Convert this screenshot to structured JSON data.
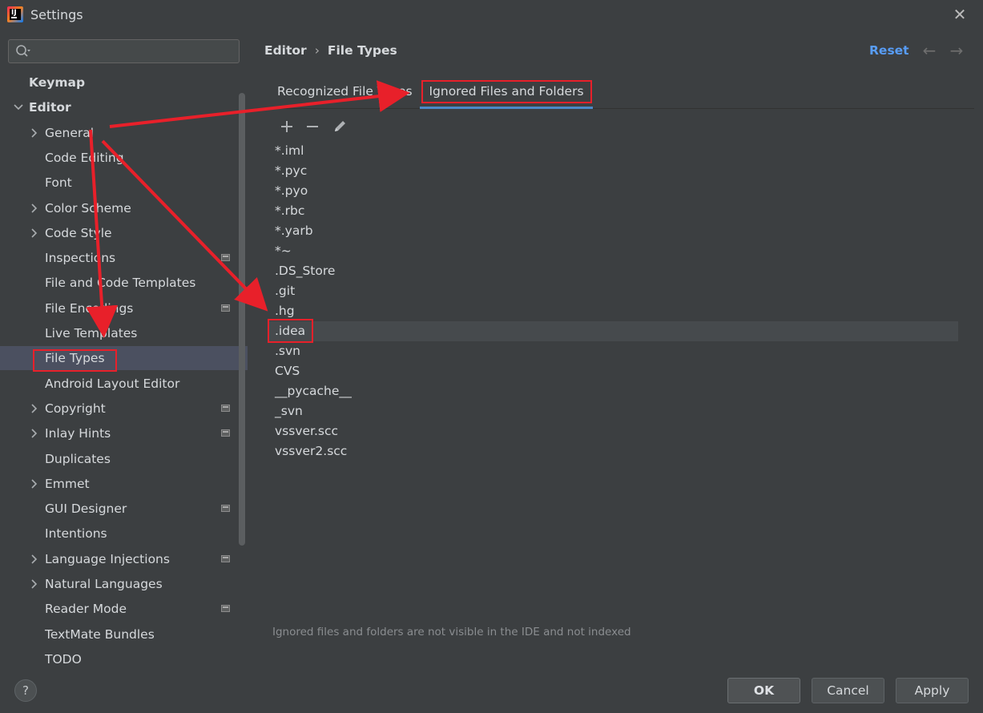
{
  "window": {
    "title": "Settings",
    "close_glyph": "✕"
  },
  "search": {
    "placeholder": "",
    "value": ""
  },
  "sidebar": {
    "items": [
      {
        "label": "Keymap",
        "bold": true,
        "expandable": false,
        "expanded": false,
        "indent": 0,
        "project": false
      },
      {
        "label": "Editor",
        "bold": true,
        "expandable": true,
        "expanded": true,
        "indent": 0,
        "project": false
      },
      {
        "label": "General",
        "bold": false,
        "expandable": true,
        "expanded": false,
        "indent": 1,
        "project": false
      },
      {
        "label": "Code Editing",
        "bold": false,
        "expandable": false,
        "expanded": false,
        "indent": 1,
        "project": false
      },
      {
        "label": "Font",
        "bold": false,
        "expandable": false,
        "expanded": false,
        "indent": 1,
        "project": false
      },
      {
        "label": "Color Scheme",
        "bold": false,
        "expandable": true,
        "expanded": false,
        "indent": 1,
        "project": false
      },
      {
        "label": "Code Style",
        "bold": false,
        "expandable": true,
        "expanded": false,
        "indent": 1,
        "project": false
      },
      {
        "label": "Inspections",
        "bold": false,
        "expandable": false,
        "expanded": false,
        "indent": 1,
        "project": true
      },
      {
        "label": "File and Code Templates",
        "bold": false,
        "expandable": false,
        "expanded": false,
        "indent": 1,
        "project": false
      },
      {
        "label": "File Encodings",
        "bold": false,
        "expandable": false,
        "expanded": false,
        "indent": 1,
        "project": true
      },
      {
        "label": "Live Templates",
        "bold": false,
        "expandable": false,
        "expanded": false,
        "indent": 1,
        "project": false
      },
      {
        "label": "File Types",
        "bold": false,
        "expandable": false,
        "expanded": false,
        "indent": 1,
        "project": false,
        "selected": true
      },
      {
        "label": "Android Layout Editor",
        "bold": false,
        "expandable": false,
        "expanded": false,
        "indent": 1,
        "project": false
      },
      {
        "label": "Copyright",
        "bold": false,
        "expandable": true,
        "expanded": false,
        "indent": 1,
        "project": true
      },
      {
        "label": "Inlay Hints",
        "bold": false,
        "expandable": true,
        "expanded": false,
        "indent": 1,
        "project": true
      },
      {
        "label": "Duplicates",
        "bold": false,
        "expandable": false,
        "expanded": false,
        "indent": 1,
        "project": false
      },
      {
        "label": "Emmet",
        "bold": false,
        "expandable": true,
        "expanded": false,
        "indent": 1,
        "project": false
      },
      {
        "label": "GUI Designer",
        "bold": false,
        "expandable": false,
        "expanded": false,
        "indent": 1,
        "project": true
      },
      {
        "label": "Intentions",
        "bold": false,
        "expandable": false,
        "expanded": false,
        "indent": 1,
        "project": false
      },
      {
        "label": "Language Injections",
        "bold": false,
        "expandable": true,
        "expanded": false,
        "indent": 1,
        "project": true
      },
      {
        "label": "Natural Languages",
        "bold": false,
        "expandable": true,
        "expanded": false,
        "indent": 1,
        "project": false
      },
      {
        "label": "Reader Mode",
        "bold": false,
        "expandable": false,
        "expanded": false,
        "indent": 1,
        "project": true
      },
      {
        "label": "TextMate Bundles",
        "bold": false,
        "expandable": false,
        "expanded": false,
        "indent": 1,
        "project": false
      },
      {
        "label": "TODO",
        "bold": false,
        "expandable": false,
        "expanded": false,
        "indent": 1,
        "project": false
      }
    ]
  },
  "header": {
    "breadcrumb_parent": "Editor",
    "breadcrumb_sep": "›",
    "breadcrumb_current": "File Types",
    "reset_label": "Reset",
    "back_glyph": "←",
    "forward_glyph": "→"
  },
  "tabs": [
    {
      "label": "Recognized File Types",
      "active": false
    },
    {
      "label": "Ignored Files and Folders",
      "active": true
    }
  ],
  "toolbar": {
    "add_icon": "plus-icon",
    "remove_icon": "minus-icon",
    "edit_icon": "pencil-icon"
  },
  "ignored_list": {
    "items": [
      "*.iml",
      "*.pyc",
      "*.pyo",
      "*.rbc",
      "*.yarb",
      "*~",
      ".DS_Store",
      ".git",
      ".hg",
      ".idea",
      ".svn",
      "CVS",
      "__pycache__",
      "_svn",
      "vssver.scc",
      "vssver2.scc"
    ],
    "selected": ".idea"
  },
  "hint": "Ignored files and folders are not visible in the IDE and not indexed",
  "buttons": {
    "help_label": "?",
    "ok_label": "OK",
    "cancel_label": "Cancel",
    "apply_label": "Apply"
  },
  "colors": {
    "background": "#3c3f41",
    "accent_link": "#589df6",
    "tab_underline": "#4a88c7",
    "selection": "#4b5060",
    "annotation_red": "#e8202a"
  }
}
